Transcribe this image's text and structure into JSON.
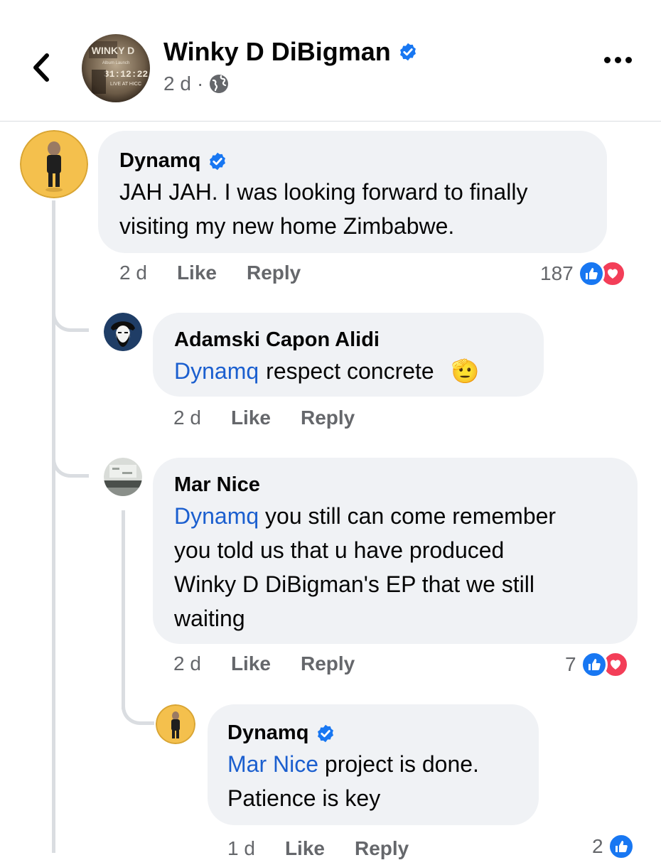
{
  "header": {
    "page_name": "Winky D DiBigman",
    "time": "2 d",
    "separator": "·",
    "avatar_text": [
      "WINKY D",
      "Album Launch",
      "31:12:22",
      "LIVE AT HICC"
    ]
  },
  "comments": [
    {
      "author": "Dynamq",
      "verified": true,
      "text_lines": [
        "JAH JAH. I was looking forward to finally",
        "visiting my new home Zimbabwe."
      ],
      "time": "2 d",
      "like_label": "Like",
      "reply_label": "Reply",
      "reaction_count": "187",
      "reactions": [
        "like-icon",
        "love-icon"
      ]
    },
    {
      "author": "Adamski Capon Alidi",
      "mention": "Dynamq",
      "text": "respect concrete",
      "emoji": "🫡",
      "time": "2 d",
      "like_label": "Like",
      "reply_label": "Reply"
    },
    {
      "author": "Mar Nice",
      "mention": "Dynamq",
      "text_lines": [
        "you  still can come remember",
        "you told us that u have produced",
        "Winky D DiBigman's EP  that  we still",
        "waiting"
      ],
      "time": "2 d",
      "like_label": "Like",
      "reply_label": "Reply",
      "reaction_count": "7",
      "reactions": [
        "like-icon",
        "love-icon"
      ]
    },
    {
      "author": "Dynamq",
      "verified": true,
      "mention": "Mar Nice",
      "text_lines": [
        "project is done.",
        "Patience is key"
      ],
      "time": "1 d",
      "like_label": "Like",
      "reply_label": "Reply",
      "reaction_count": "2",
      "reactions": [
        "like-icon"
      ]
    }
  ],
  "colors": {
    "accent": "#1877f2",
    "mention": "#1b5fcf",
    "bubble": "#f0f2f5",
    "secondary_text": "#65676b",
    "love": "#f33e58"
  }
}
